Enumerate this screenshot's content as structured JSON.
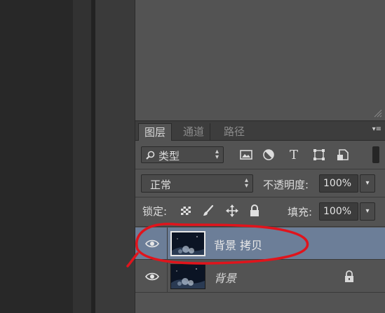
{
  "tabs": [
    {
      "label": "图层",
      "active": true
    },
    {
      "label": "通道",
      "active": false
    },
    {
      "label": "路径",
      "active": false
    }
  ],
  "filter": {
    "label": "类型",
    "icons": [
      "image-filter-icon",
      "adjustment-filter-icon",
      "type-filter-icon",
      "shape-filter-icon",
      "smart-object-filter-icon"
    ]
  },
  "blend": {
    "mode": "正常",
    "opacity_label": "不透明度:",
    "opacity_value": "100%"
  },
  "lock": {
    "label": "锁定:",
    "fill_label": "填充:",
    "fill_value": "100%"
  },
  "layers": [
    {
      "name": "背景 拷贝",
      "selected": true,
      "visible": true,
      "locked": false
    },
    {
      "name": "背景",
      "selected": false,
      "visible": true,
      "locked": true
    }
  ],
  "colors": {
    "selected_row": "#6c7e98",
    "panel_bg": "#535353",
    "annotation_stroke": "#e0141c"
  }
}
